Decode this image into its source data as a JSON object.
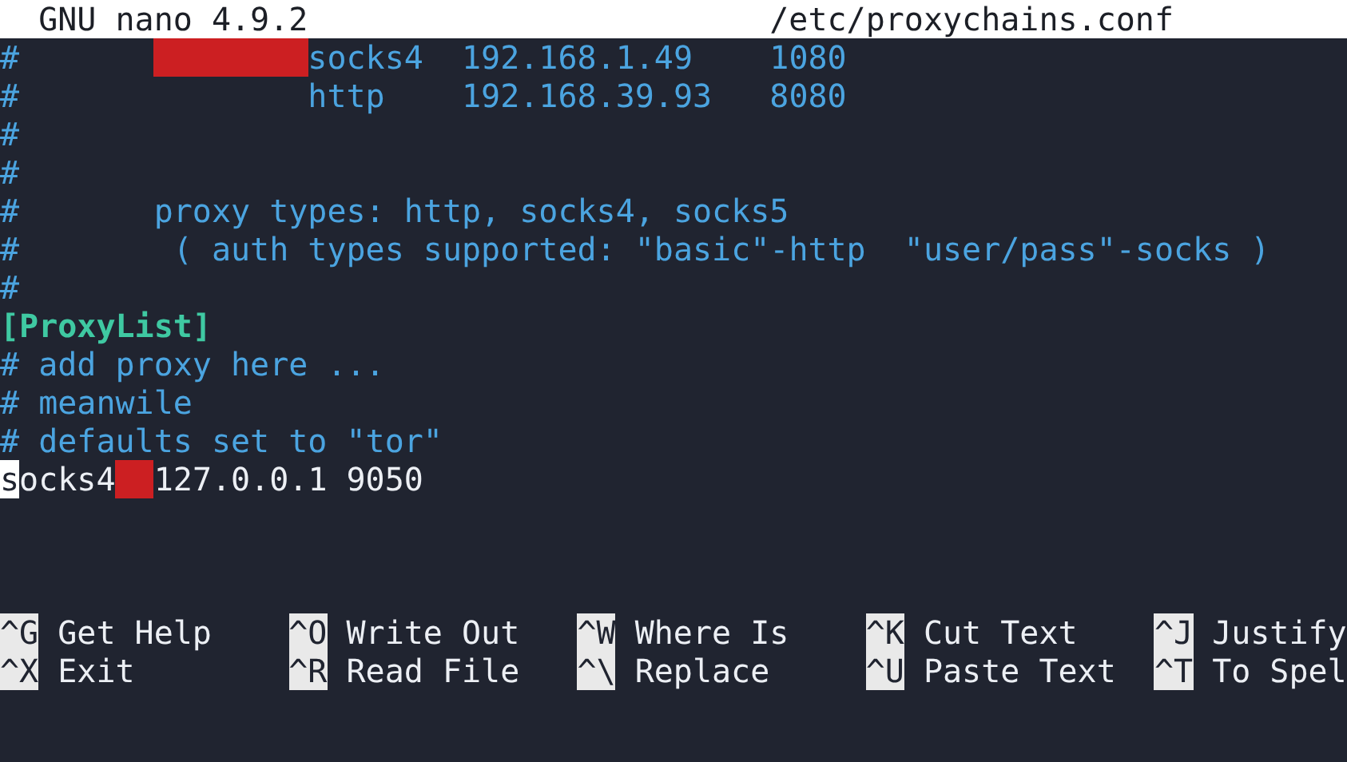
{
  "title_bar": {
    "app": "GNU nano 4.9.2",
    "file": "/etc/proxychains.conf"
  },
  "lines": [
    {
      "items": [
        {
          "kind": "comment",
          "text": "#       "
        },
        {
          "kind": "comment",
          "text": "        socks4  192.168.1.49    1080",
          "redacted": true
        }
      ]
    },
    {
      "items": [
        {
          "kind": "comment",
          "text": "#"
        },
        {
          "kind": "comment",
          "text": "               http    192.168.39.93   8080"
        }
      ]
    },
    {
      "items": [
        {
          "kind": "comment",
          "text": "#"
        }
      ]
    },
    {
      "items": [
        {
          "kind": "comment",
          "text": "#"
        }
      ]
    },
    {
      "items": [
        {
          "kind": "comment",
          "text": "#"
        },
        {
          "kind": "comment",
          "text": "       proxy types: http, socks4, socks5"
        }
      ]
    },
    {
      "items": [
        {
          "kind": "comment",
          "text": "#"
        },
        {
          "kind": "comment",
          "text": "        ( auth types supported: \"basic\"-http  \"user/pass\"-socks )"
        }
      ]
    },
    {
      "items": [
        {
          "kind": "comment",
          "text": "#"
        }
      ]
    },
    {
      "items": [
        {
          "kind": "section",
          "text": "[ProxyList]"
        }
      ]
    },
    {
      "items": [
        {
          "kind": "comment",
          "text": "# add proxy here ..."
        }
      ]
    },
    {
      "items": [
        {
          "kind": "comment",
          "text": "# meanwile"
        }
      ]
    },
    {
      "items": [
        {
          "kind": "comment",
          "text": "# defaults set to \"tor\""
        }
      ]
    },
    {
      "items": [
        {
          "kind": "plain",
          "text": "socks4",
          "cursor": true
        },
        {
          "kind": "plain",
          "text": "  127.0.0.1 9050",
          "cursor": false,
          "redacted": true
        }
      ]
    }
  ],
  "shortcuts": [
    [
      {
        "key": "^G",
        "label": "Get Help"
      },
      {
        "key": "^O",
        "label": "Write Out"
      },
      {
        "key": "^W",
        "label": "Where Is"
      },
      {
        "key": "^K",
        "label": "Cut Text"
      },
      {
        "key": "^J",
        "label": "Justify"
      }
    ],
    [
      {
        "key": "^X",
        "label": "Exit"
      },
      {
        "key": "^R",
        "label": "Read File"
      },
      {
        "key": "^\\",
        "label": "Replace"
      },
      {
        "key": "^U",
        "label": "Paste Text"
      },
      {
        "key": "^T",
        "label": "To Spel"
      }
    ]
  ]
}
